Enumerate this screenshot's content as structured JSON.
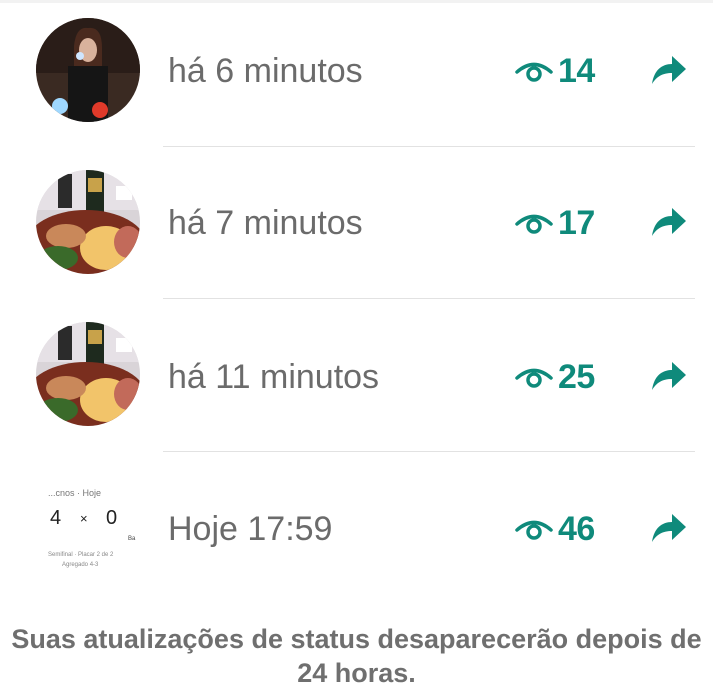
{
  "status_updates": [
    {
      "time": "há 6 minutos",
      "views": "14",
      "thumbnail": "person-photo"
    },
    {
      "time": "há 7 minutos",
      "views": "17",
      "thumbnail": "food-platter-photo"
    },
    {
      "time": "há 11 minutos",
      "views": "25",
      "thumbnail": "food-platter-photo"
    },
    {
      "time": "Hoje 17:59",
      "views": "46",
      "thumbnail": "score-card-image"
    }
  ],
  "score_thumbnail": {
    "header": "...cnos · Hoje",
    "score_home": "4",
    "separator": "×",
    "score_away": "0",
    "side_label": "Ba",
    "line1": "Semifinal · Placar 2 de 2",
    "line2": "Agregado 4-3"
  },
  "footer": {
    "text": "Suas atualizações de status desaparecerão depois de 24 horas."
  },
  "colors": {
    "accent": "#0f8a7b",
    "time_text": "#6b6b6b",
    "divider": "#e2e2e2",
    "footer_text": "#6f6f6f"
  },
  "icons": {
    "views": "eye-icon",
    "share": "forward-arrow-icon"
  }
}
